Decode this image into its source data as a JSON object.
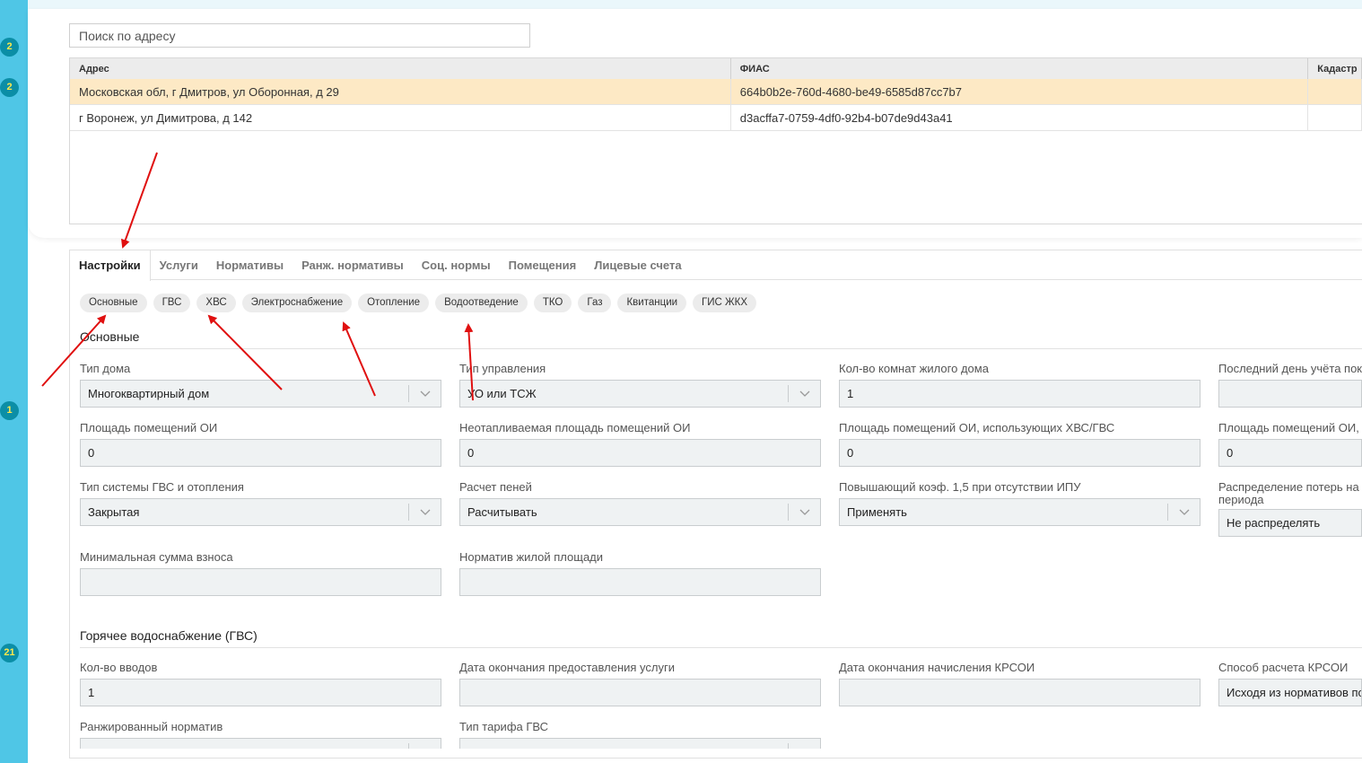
{
  "sidebar": {
    "badges": [
      "2",
      "2",
      "1",
      "21"
    ]
  },
  "search": {
    "placeholder": "Поиск по адресу"
  },
  "address_table": {
    "columns": [
      "Адрес",
      "ФИАС",
      "Кадастр"
    ],
    "rows": [
      {
        "address": "Московская обл, г Дмитров, ул Оборонная, д 29",
        "fias": "664b0b2e-760d-4680-be49-6585d87cc7b7",
        "selected": true
      },
      {
        "address": "г Воронеж, ул Димитрова, д 142",
        "fias": "d3acffa7-0759-4df0-92b4-b07de9d43a41",
        "selected": false
      }
    ]
  },
  "tabs": [
    "Настройки",
    "Услуги",
    "Нормативы",
    "Ранж. нормативы",
    "Соц. нормы",
    "Помещения",
    "Лицевые счета"
  ],
  "subtabs": [
    "Основные",
    "ГВС",
    "ХВС",
    "Электроснабжение",
    "Отопление",
    "Водоотведение",
    "ТКО",
    "Газ",
    "Квитанции",
    "ГИС ЖКХ"
  ],
  "sections": {
    "main": {
      "title": "Основные",
      "fields": {
        "house_type": {
          "label": "Тип дома",
          "value": "Многоквартирный дом"
        },
        "management_type": {
          "label": "Тип управления",
          "value": "УО или ТСЖ"
        },
        "rooms_count": {
          "label": "Кол-во комнат жилого дома",
          "value": "1"
        },
        "last_day": {
          "label": "Последний день учёта пок",
          "value": ""
        },
        "oi_area": {
          "label": "Площадь помещений ОИ",
          "value": "0"
        },
        "unheated_oi_area": {
          "label": "Неотапливаемая площадь помещений ОИ",
          "value": "0"
        },
        "oi_area_hvs_gvs": {
          "label": "Площадь помещений ОИ, использующих ХВС/ГВС",
          "value": "0"
        },
        "oi_area_cut": {
          "label": "Площадь помещений ОИ, и",
          "value": "0"
        },
        "gvs_heating_system": {
          "label": "Тип системы ГВС и отопления",
          "value": "Закрытая"
        },
        "penalty_calc": {
          "label": "Расчет пеней",
          "value": "Расчитывать"
        },
        "coef_15": {
          "label": "Повышающий коэф. 1,5 при отсутствии ИПУ",
          "value": "Применять"
        },
        "loss_distribution": {
          "label_line1": "Распределение потерь на",
          "label_line2": "периода",
          "value": "Не распределять"
        },
        "min_contribution": {
          "label": "Минимальная сумма взноса",
          "value": ""
        },
        "living_area_norm": {
          "label": "Норматив жилой площади",
          "value": ""
        }
      }
    },
    "gvs": {
      "title": "Горячее водоснабжение (ГВС)",
      "fields": {
        "inputs_count": {
          "label": "Кол-во вводов",
          "value": "1"
        },
        "service_end_date": {
          "label": "Дата окончания предоставления услуги",
          "value": ""
        },
        "krsoi_end_date": {
          "label": "Дата окончания начисления КРСОИ",
          "value": ""
        },
        "krsoi_method": {
          "label": "Способ расчета КРСОИ",
          "value": "Исходя из нормативов по"
        },
        "ranked_norm": {
          "label": "Ранжированный норматив",
          "value": ""
        },
        "gvs_tariff_type": {
          "label": "Тип тарифа ГВС",
          "value": ""
        }
      }
    }
  },
  "colors": {
    "strip": "#4fc6e6",
    "badge": "#0b8ea6",
    "selected_row": "#fde9c5",
    "arrow": "#e01010"
  }
}
